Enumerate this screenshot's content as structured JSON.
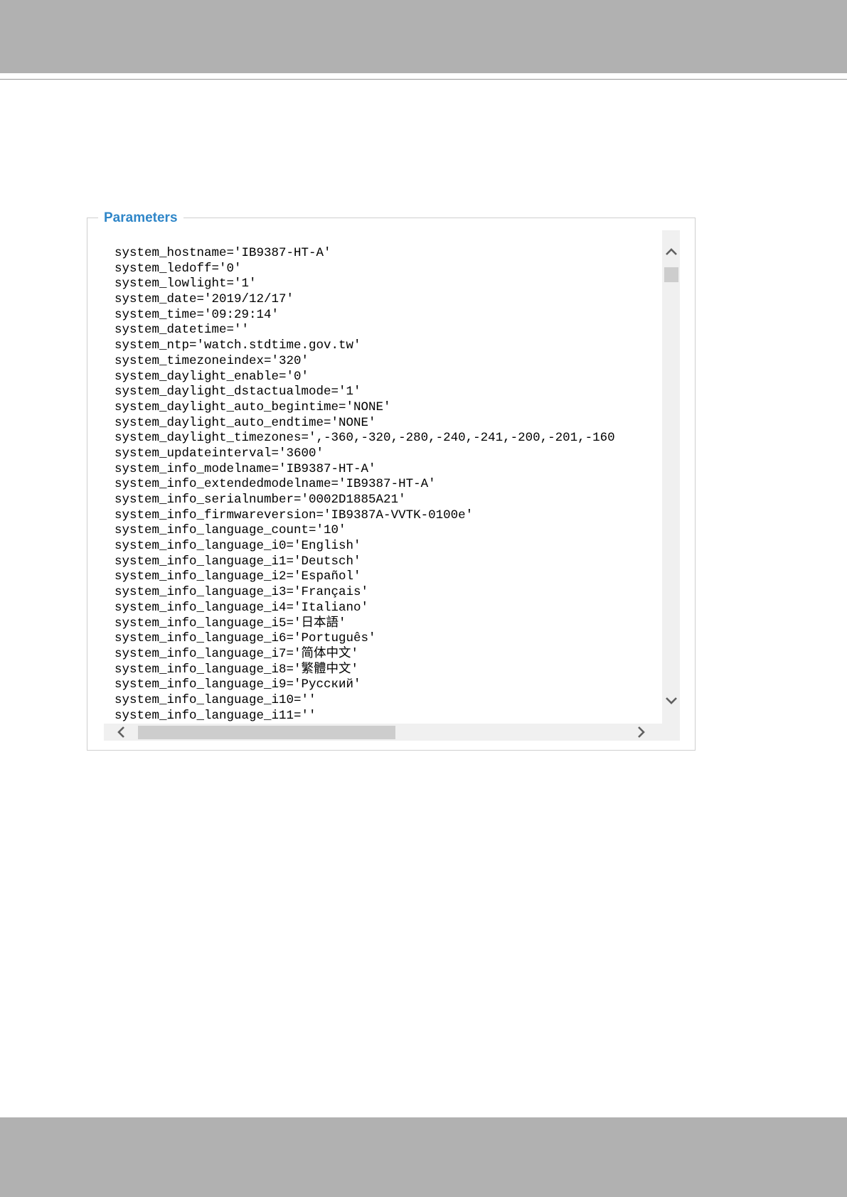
{
  "panel": {
    "legend": "Parameters",
    "lines": [
      "system_hostname='IB9387-HT-A'",
      "system_ledoff='0'",
      "system_lowlight='1'",
      "system_date='2019/12/17'",
      "system_time='09:29:14'",
      "system_datetime=''",
      "system_ntp='watch.stdtime.gov.tw'",
      "system_timezoneindex='320'",
      "system_daylight_enable='0'",
      "system_daylight_dstactualmode='1'",
      "system_daylight_auto_begintime='NONE'",
      "system_daylight_auto_endtime='NONE'",
      "system_daylight_timezones=',-360,-320,-280,-240,-241,-200,-201,-160",
      "system_updateinterval='3600'",
      "system_info_modelname='IB9387-HT-A'",
      "system_info_extendedmodelname='IB9387-HT-A'",
      "system_info_serialnumber='0002D1885A21'",
      "system_info_firmwareversion='IB9387A-VVTK-0100e'",
      "system_info_language_count='10'",
      "system_info_language_i0='English'",
      "system_info_language_i1='Deutsch'",
      "system_info_language_i2='Español'",
      "system_info_language_i3='Français'",
      "system_info_language_i4='Italiano'",
      "system_info_language_i5='日本語'",
      "system_info_language_i6='Português'",
      "system_info_language_i7='简体中文'",
      "system_info_language_i8='繁體中文'",
      "system_info_language_i9='Русский'",
      "system_info_language_i10=''",
      "system_info_language_i11=''"
    ],
    "icons": {
      "scroll_up": "chevron-up-icon",
      "scroll_down": "chevron-down-icon",
      "scroll_left": "chevron-left-icon",
      "scroll_right": "chevron-right-icon"
    }
  },
  "colors": {
    "legend": "#2f86c8",
    "page_bands": "#b1b1b1",
    "scrollbar_track": "#f0f0f0",
    "scrollbar_thumb": "#cdcdcd"
  }
}
